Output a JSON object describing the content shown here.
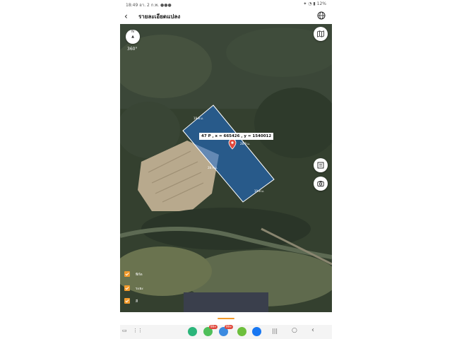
{
  "status_bar": {
    "time": "18:49",
    "date": "อา. 2 ก.พ.",
    "battery": "12%"
  },
  "app_bar": {
    "title": "รายละเอียดแปลง"
  },
  "map": {
    "rotation_label": "360°",
    "coordinate_label": "47 P , x = 665426 , y = 1540012",
    "edge_labels": [
      "19.8 ม.",
      "28.9 ม.",
      "28.9 ม.",
      "19.8 ม."
    ],
    "compass_letters": "N"
  },
  "layers": [
    {
      "label": "พิกัด",
      "checked": true
    },
    {
      "label": "ระยะ",
      "checked": true
    },
    {
      "label": "สี",
      "checked": true
    }
  ],
  "nav_bar": {
    "badges": [
      "99+",
      "99+"
    ]
  },
  "colors": {
    "accent": "#f39a2b",
    "parcel_fill": "#1f6fd6",
    "pin": "#e0493d"
  },
  "icons": [
    "back-arrow-icon",
    "globe-icon",
    "compass-icon",
    "map-type-icon",
    "ruler-icon",
    "camera-icon",
    "location-pin-icon",
    "check-icon"
  ]
}
